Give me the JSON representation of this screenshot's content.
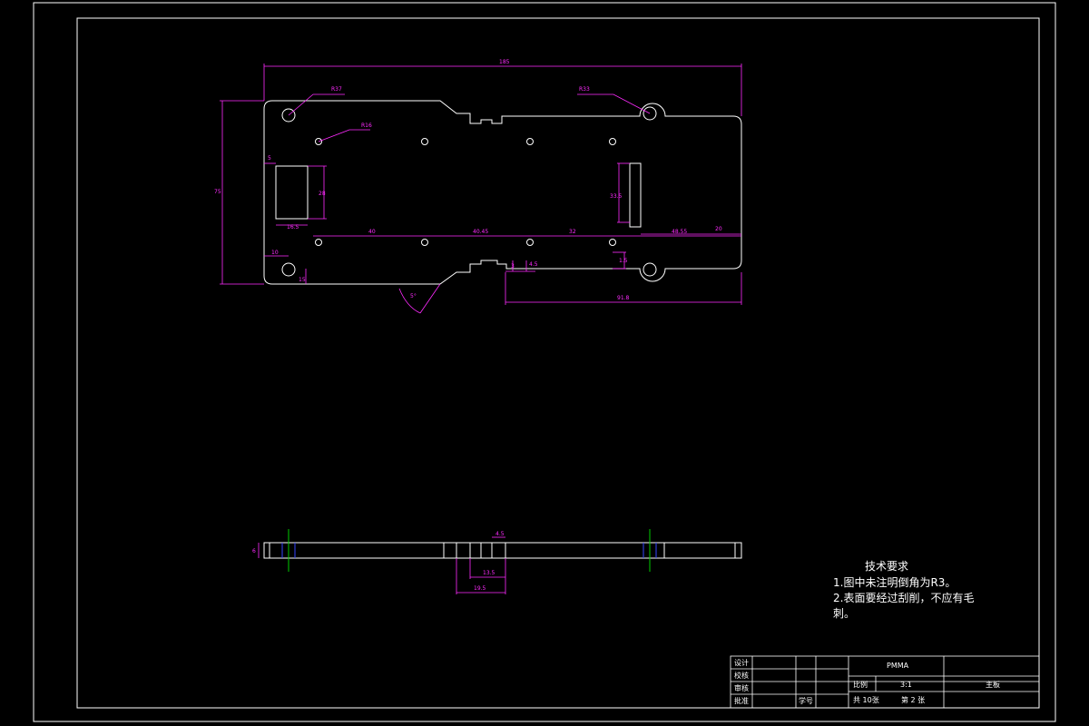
{
  "dimensions": {
    "overall_length": "185",
    "overall_height": "75",
    "radius_top_left": "R37",
    "radius_top_right": "R33",
    "radius_hole": "R16",
    "left_edge": "5",
    "left_hole_offset": "10",
    "bottom_hole_offset": "15",
    "slot_height": "28",
    "slot_width": "16.5",
    "right_slot_height": "33.5",
    "hole_spacing_1": "40",
    "hole_spacing_2": "40.45",
    "hole_spacing_3": "32",
    "right_distance": "48.55",
    "right_edge": "20",
    "notch_depth": "3",
    "notch_width": "4.5",
    "small_dim": "1.5",
    "bottom_length": "91.8",
    "angle": "5°",
    "thickness": "6",
    "side_notch": "4.5",
    "side_width_1": "13.5",
    "side_width_2": "19.5"
  },
  "notes": {
    "title": "技术要求",
    "line1": "1.图中未注明倒角为R3。",
    "line2a": "2.表面要经过刮削，不应有毛",
    "line2b": "刺。"
  },
  "title_block": {
    "designer": "设计",
    "checker": "校核",
    "reviewer": "审核",
    "approver": "批准",
    "material": "PMMA",
    "scale_label": "比例",
    "scale_value": "3:1",
    "part_name": "主板",
    "total_sheets": "共 10张",
    "sheet_no": "第 2 张",
    "school": "学号"
  },
  "colors": {
    "background": "#000000",
    "outline": "#ffffff",
    "dimension": "#ff2bff",
    "centerline": "#00cc00",
    "hidden": "#3344ff"
  }
}
